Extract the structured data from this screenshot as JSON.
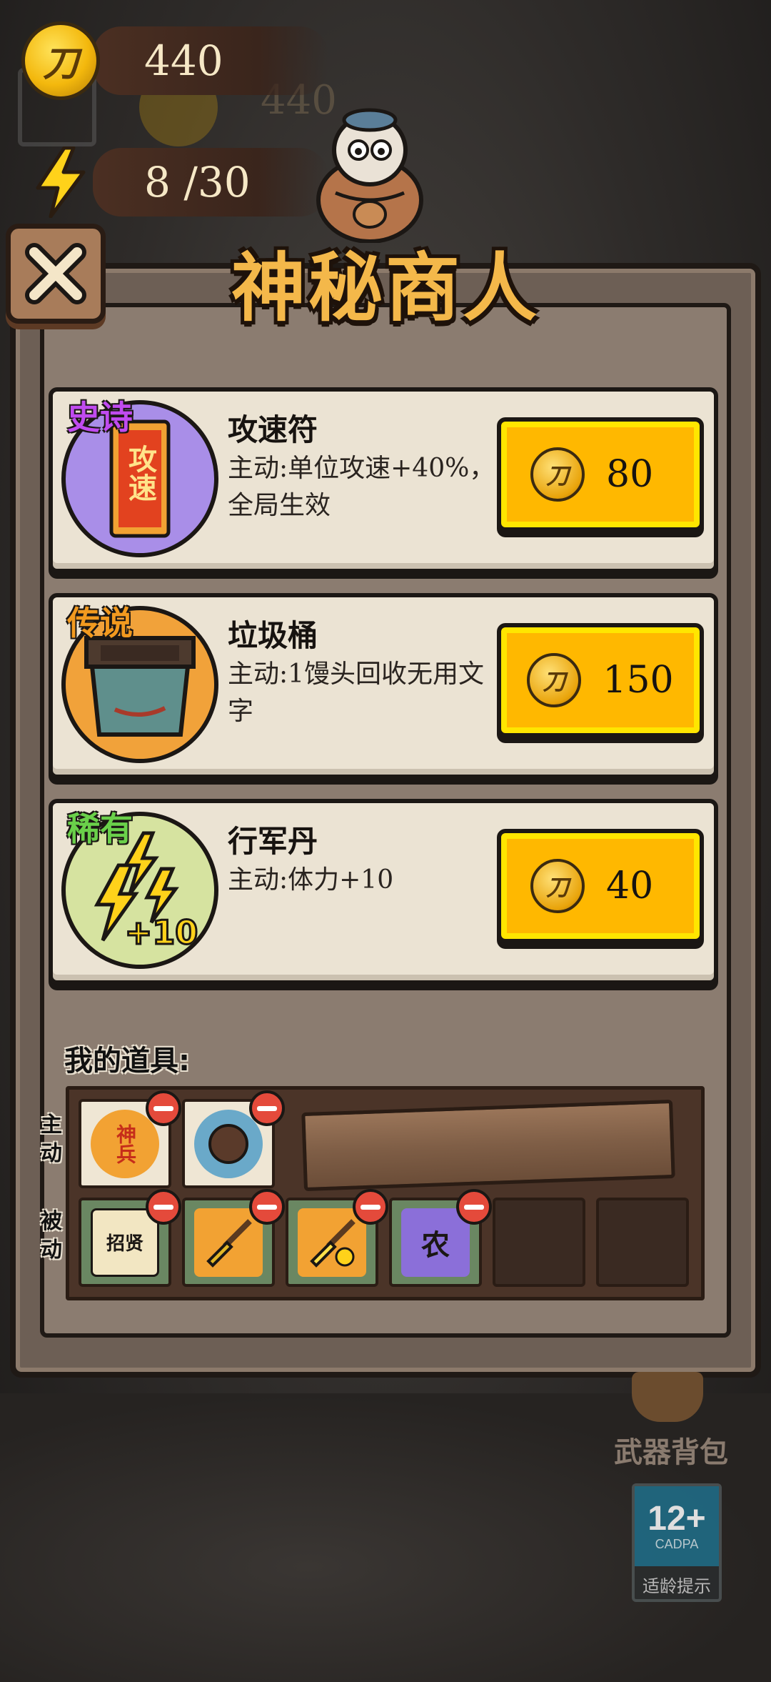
{
  "hud": {
    "coin_glyph": "刀",
    "coins": "440",
    "energy": "8 /30",
    "ghost_coins": "440"
  },
  "title": "神秘商人",
  "shop_items": [
    {
      "rarity": "史诗",
      "rarity_color": "#c04bf0",
      "circle_color": "#a98ee8",
      "name": "攻速符",
      "desc": "主动:单位攻速+40%，全局生效",
      "price": "80",
      "icon": "attack-speed-talisman-icon",
      "icon_text": "攻速"
    },
    {
      "rarity": "传说",
      "rarity_color": "#f29a1f",
      "circle_color": "#f1a23a",
      "name": "垃圾桶",
      "desc": "主动:1馒头回收无用文字",
      "price": "150",
      "icon": "trash-bin-icon"
    },
    {
      "rarity": "稀有",
      "rarity_color": "#6ad04a",
      "circle_color": "#d6e3a0",
      "name": "行军丹",
      "desc": "主动:体力+10",
      "price": "40",
      "icon": "energy-plus-icon",
      "icon_text": "+10"
    }
  ],
  "my_items": {
    "label": "我的道具:",
    "active_label": "主动",
    "passive_label": "被动",
    "active": [
      {
        "icon": "divine-soldier-icon",
        "text": "神兵",
        "color": "#f2a233"
      },
      {
        "icon": "bomb-pot-icon",
        "text": "",
        "color": "#6aa9c9"
      }
    ],
    "passive": [
      {
        "icon": "recruit-scroll-icon",
        "text": "招贤",
        "color": "#f2e6c2"
      },
      {
        "icon": "shovel-icon",
        "text": "",
        "color": "#f2a233"
      },
      {
        "icon": "golden-shovel-icon",
        "text": "",
        "color": "#f2a233"
      },
      {
        "icon": "farm-icon",
        "text": "农",
        "color": "#8b6fd9"
      }
    ]
  },
  "weapon_bag": "武器背包",
  "age_rating": {
    "num": "12+",
    "org": "CADPA",
    "label": "适龄提示"
  }
}
